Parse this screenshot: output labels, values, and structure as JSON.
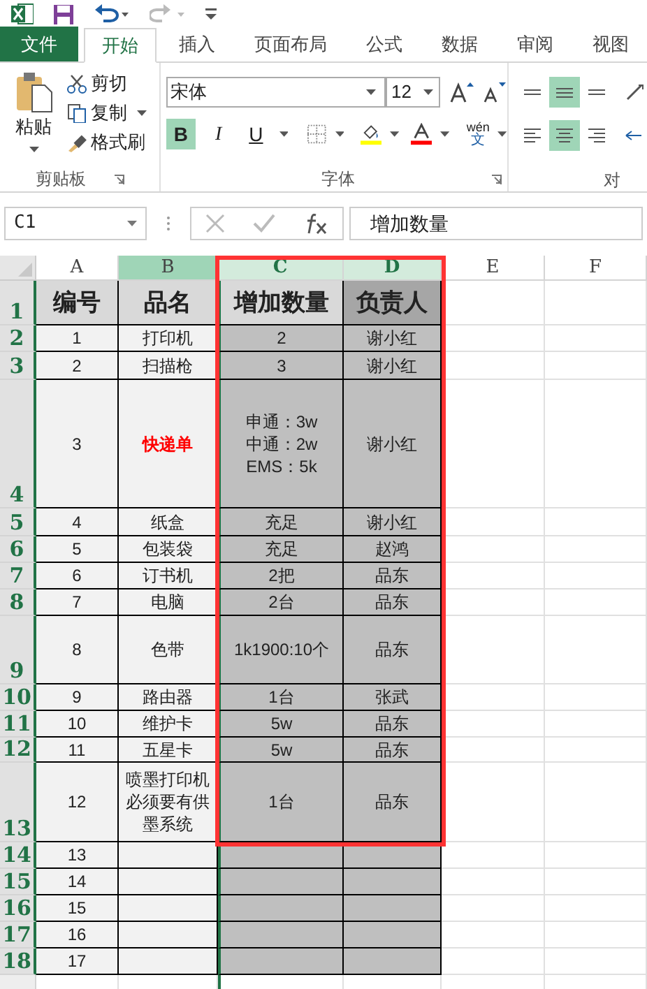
{
  "tabs": [
    {
      "label": "文件",
      "kind": "file",
      "selected": false
    },
    {
      "label": "开始",
      "kind": "tab",
      "selected": true
    },
    {
      "label": "插入",
      "kind": "tab",
      "selected": false
    },
    {
      "label": "页面布局",
      "kind": "tab",
      "selected": false
    },
    {
      "label": "公式",
      "kind": "tab",
      "selected": false
    },
    {
      "label": "数据",
      "kind": "tab",
      "selected": false
    },
    {
      "label": "审阅",
      "kind": "tab",
      "selected": false
    },
    {
      "label": "视图",
      "kind": "tab",
      "selected": false
    }
  ],
  "clipboard": {
    "paste": "粘贴",
    "cut": "剪切",
    "copy": "复制",
    "format_painter": "格式刷",
    "group_label": "剪贴板"
  },
  "font": {
    "name": "宋体",
    "size": "12",
    "group_label": "字体",
    "phonetic": "wén",
    "phonetic_char": "文",
    "buttons": [
      {
        "label": "B",
        "kind": "bold",
        "selected": true
      },
      {
        "label": "I",
        "kind": "italic",
        "selected": false
      },
      {
        "label": "U",
        "kind": "underline",
        "selected": false
      }
    ]
  },
  "alignment": {
    "group_label": "对",
    "top_row": [
      {
        "kind": "top",
        "selected": false
      },
      {
        "kind": "middle",
        "selected": true
      },
      {
        "kind": "bottom",
        "selected": false
      }
    ],
    "bottom_row": [
      {
        "kind": "left",
        "selected": false
      },
      {
        "kind": "center",
        "selected": true
      },
      {
        "kind": "right",
        "selected": false
      }
    ]
  },
  "name_box": "C1",
  "formula": "增加数量",
  "columns": [
    {
      "label": "A",
      "selected": false,
      "outlined": false
    },
    {
      "label": "B",
      "selected": true,
      "outlined": false
    },
    {
      "label": "C",
      "selected": true,
      "outlined": true
    },
    {
      "label": "D",
      "selected": true,
      "outlined": true
    },
    {
      "label": "E",
      "selected": false,
      "outlined": false
    },
    {
      "label": "F",
      "selected": false,
      "outlined": false
    }
  ],
  "rows": [
    {
      "header": "1",
      "selected": true,
      "cells": [
        "编号",
        "品名",
        "增加数量",
        "负责人",
        "",
        ""
      ]
    },
    {
      "header": "2",
      "selected": true,
      "cells": [
        "1",
        "打印机",
        "2",
        "谢小红",
        "",
        ""
      ]
    },
    {
      "header": "3",
      "selected": true,
      "cells": [
        "2",
        "扫描枪",
        "3",
        "谢小红",
        "",
        ""
      ]
    },
    {
      "header": "4",
      "selected": true,
      "cells": [
        "3",
        {
          "text": "快递单",
          "highlight": true
        },
        "申通：3w\n中通：2w\nEMS：5k",
        "谢小红",
        "",
        ""
      ]
    },
    {
      "header": "5",
      "selected": true,
      "cells": [
        "4",
        "纸盒",
        "充足",
        "谢小红",
        "",
        ""
      ]
    },
    {
      "header": "6",
      "selected": true,
      "cells": [
        "5",
        "包装袋",
        "充足",
        "赵鸿",
        "",
        ""
      ]
    },
    {
      "header": "7",
      "selected": true,
      "cells": [
        "6",
        "订书机",
        "2把",
        "品东",
        "",
        ""
      ]
    },
    {
      "header": "8",
      "selected": true,
      "cells": [
        "7",
        "电脑",
        "2台",
        "品东",
        "",
        ""
      ]
    },
    {
      "header": "9",
      "selected": true,
      "cells": [
        "8",
        "色带",
        "1k1900:10个",
        "品东",
        "",
        ""
      ]
    },
    {
      "header": "10",
      "selected": true,
      "cells": [
        "9",
        "路由器",
        "1台",
        "张武",
        "",
        ""
      ]
    },
    {
      "header": "11",
      "selected": true,
      "cells": [
        "10",
        "维护卡",
        "5w",
        "品东",
        "",
        ""
      ]
    },
    {
      "header": "12",
      "selected": true,
      "cells": [
        "11",
        "五星卡",
        "5w",
        "品东",
        "",
        ""
      ]
    },
    {
      "header": "13",
      "selected": true,
      "cells": [
        "12",
        "喷墨打印机必须要有供墨系统",
        "1台",
        "品东",
        "",
        ""
      ]
    },
    {
      "header": "14",
      "selected": true,
      "cells": [
        "13",
        "",
        "",
        "",
        "",
        ""
      ]
    },
    {
      "header": "15",
      "selected": true,
      "cells": [
        "14",
        "",
        "",
        "",
        "",
        ""
      ]
    },
    {
      "header": "16",
      "selected": true,
      "cells": [
        "15",
        "",
        "",
        "",
        "",
        ""
      ]
    },
    {
      "header": "17",
      "selected": true,
      "cells": [
        "16",
        "",
        "",
        "",
        "",
        ""
      ]
    },
    {
      "header": "18",
      "selected": true,
      "cells": [
        "17",
        "",
        "",
        "",
        "",
        ""
      ]
    },
    {
      "selected": false,
      "cells": [
        "",
        "",
        "",
        "",
        "",
        ""
      ]
    }
  ]
}
